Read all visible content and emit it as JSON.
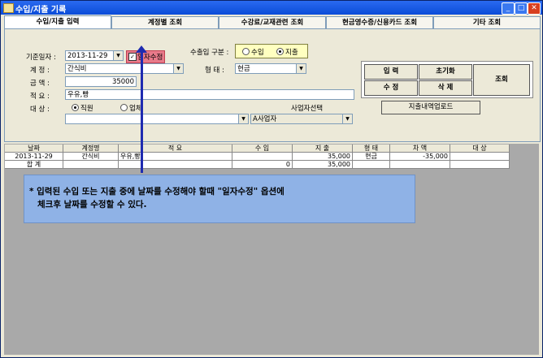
{
  "window": {
    "title": "수입/지출 기록"
  },
  "tabs": [
    {
      "label": "수입/지출 입력"
    },
    {
      "label": "계정별 조회"
    },
    {
      "label": "수강료/교재관련 조회"
    },
    {
      "label": "현금영수증/신용카드 조회"
    },
    {
      "label": "기타 조회"
    }
  ],
  "form": {
    "date_label": "기준일자 :",
    "date_value": "2013-11-29",
    "date_edit_label": "일자수정",
    "account_label": "계 정 :",
    "account_value": "간식비",
    "amount_label": "금 액 :",
    "amount_value": "35000",
    "memo_label": "적 요 :",
    "memo_value": "우유,빵",
    "target_label": "대 상 :",
    "target_opt1": "직원",
    "target_opt2": "업체",
    "business_label": "사업자선택",
    "business_value": "A사업자",
    "inout_label": "수출입 구분 :",
    "inout_opt1": "수입",
    "inout_opt2": "지출",
    "type_label": "형 태 :",
    "type_value": "현금"
  },
  "buttons": {
    "input": "입 력",
    "init": "초기화",
    "edit": "수 정",
    "delete": "삭 제",
    "search": "조회",
    "upload": "지출내역업로드"
  },
  "grid": {
    "headers": [
      "날짜",
      "계정명",
      "적 요",
      "수 입",
      "지 출",
      "형 태",
      "차 액",
      "대 상"
    ],
    "rows": [
      {
        "date": "2013-11-29",
        "account": "간식비",
        "memo": "우유,빵",
        "income": "",
        "expense": "35,000",
        "type": "현금",
        "diff": "-35,000",
        "target": ""
      }
    ],
    "sum": {
      "label": "합 계",
      "income": "0",
      "expense": "35,000"
    }
  },
  "note": {
    "line1": "* 입력된 수입 또는 지출 중에 날짜를 수정해야 할때 \"일자수정\" 옵션에",
    "line2": "체크후 날짜를 수정할 수 있다."
  }
}
